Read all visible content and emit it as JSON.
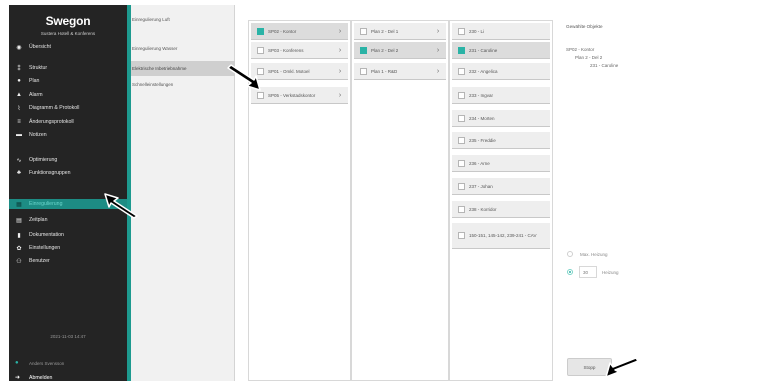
{
  "sidebar": {
    "logo": "Swegon",
    "org": "Sustera Hotell & Konferens",
    "items": [
      {
        "label": "Übersicht",
        "icon": "eye-icon"
      },
      {
        "label": "Struktur",
        "icon": "structure-icon"
      },
      {
        "label": "Plan",
        "icon": "pin-icon"
      },
      {
        "label": "Alarm",
        "icon": "bell-icon"
      },
      {
        "label": "Diagramm & Protokoll",
        "icon": "chart-icon"
      },
      {
        "label": "Änderungsprotokoll",
        "icon": "list-icon"
      },
      {
        "label": "Notizen",
        "icon": "note-icon"
      },
      {
        "label": "Optimierung",
        "icon": "wave-icon"
      },
      {
        "label": "Funktionsgruppen",
        "icon": "group-icon"
      },
      {
        "label": "Einregulierung",
        "icon": "grid-icon"
      },
      {
        "label": "Zeitplan",
        "icon": "calendar-icon"
      },
      {
        "label": "Dokumentation",
        "icon": "document-icon"
      },
      {
        "label": "Einstellungen",
        "icon": "gear-icon"
      },
      {
        "label": "Benutzer",
        "icon": "users-icon"
      }
    ],
    "timestamp": "2021-11-03 14:47",
    "user": "Anders Svensson",
    "logout": "Abmelden"
  },
  "submenu": {
    "items": [
      {
        "label": "Einregulierung Luft"
      },
      {
        "label": "Einregulierung Wasser"
      },
      {
        "label": "Elektrische Inbetriebnahme"
      },
      {
        "label": "Schnelleinstellungen"
      }
    ]
  },
  "columns": {
    "zones": [
      {
        "label": "SP02 - Kontor",
        "checked": true
      },
      {
        "label": "SP03 - Konferens",
        "checked": false
      },
      {
        "label": "SP01 - Omkl. Motoel",
        "checked": false
      },
      {
        "label": "SP05 - Verkstadskontor",
        "checked": false
      }
    ],
    "plans": [
      {
        "label": "Plan 2 - Del 1",
        "checked": false
      },
      {
        "label": "Plan 2 - Del 2",
        "checked": true
      },
      {
        "label": "Plan 1 - R&D",
        "checked": false
      }
    ],
    "rooms": [
      {
        "label": "230 - Li",
        "checked": false
      },
      {
        "label": "231 - Caroline",
        "checked": true
      },
      {
        "label": "232 - Angelica",
        "checked": false
      },
      {
        "label": "233 - Ingvar",
        "checked": false
      },
      {
        "label": "234 - Morten",
        "checked": false
      },
      {
        "label": "235 - Freddie",
        "checked": false
      },
      {
        "label": "236 - Arne",
        "checked": false
      },
      {
        "label": "237 - Johan",
        "checked": false
      },
      {
        "label": "238 - Korridor",
        "checked": false
      },
      {
        "label": "150-151, 145-142, 239-241 - CAV",
        "checked": false
      }
    ]
  },
  "selected": {
    "title": "Gewählte Objekte",
    "lines": [
      "SP02 - Kontor",
      "Plan 2 - Del 2",
      "231 - Caroline"
    ]
  },
  "options": {
    "max_heating_label": "Max. Heizung",
    "heating_label": "Heizung",
    "heating_value": "30"
  },
  "stop_label": "Stopp",
  "colors": {
    "accent": "#1d9a8f",
    "sidebar_bg": "#242424",
    "check_on": "#2ab3a6"
  }
}
